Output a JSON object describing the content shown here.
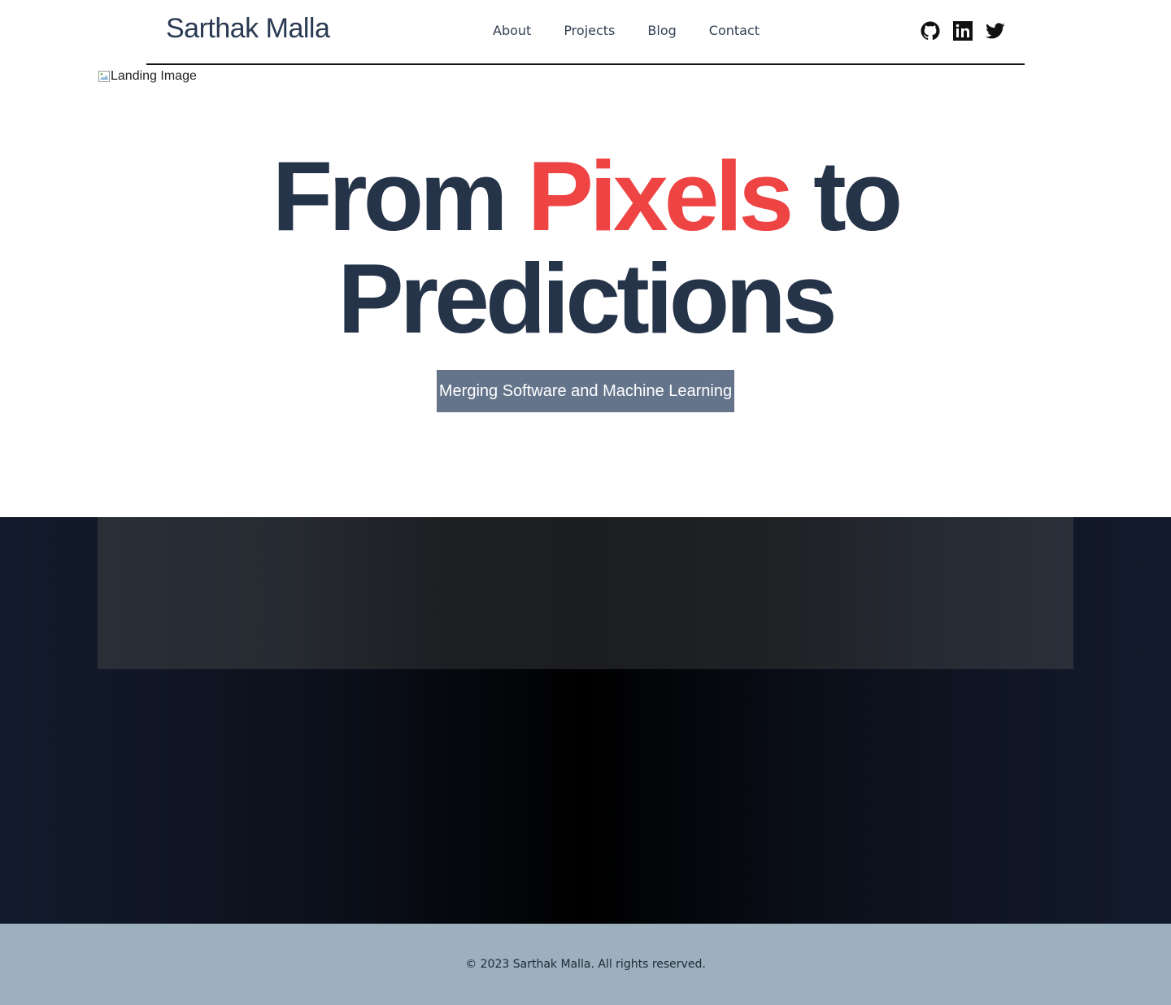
{
  "header": {
    "brand": "Sarthak Malla",
    "nav": [
      {
        "label": "About"
      },
      {
        "label": "Projects"
      },
      {
        "label": "Blog"
      },
      {
        "label": "Contact"
      }
    ],
    "social_icons": [
      "github-icon",
      "linkedin-icon",
      "twitter-icon"
    ]
  },
  "landing_image": {
    "alt": "Landing Image"
  },
  "hero": {
    "title_part1": "From ",
    "title_accent": "Pixels",
    "title_part2": " to",
    "title_line2": "Predictions",
    "tagline": "Merging Software and Machine Learning"
  },
  "footer": {
    "copyright": "© 2023 Sarthak Malla. All rights reserved."
  },
  "colors": {
    "accent": "#ef4444",
    "heading": "#263449",
    "tagline_bg": "#64748b",
    "footer_bg": "#9cb0bd"
  }
}
